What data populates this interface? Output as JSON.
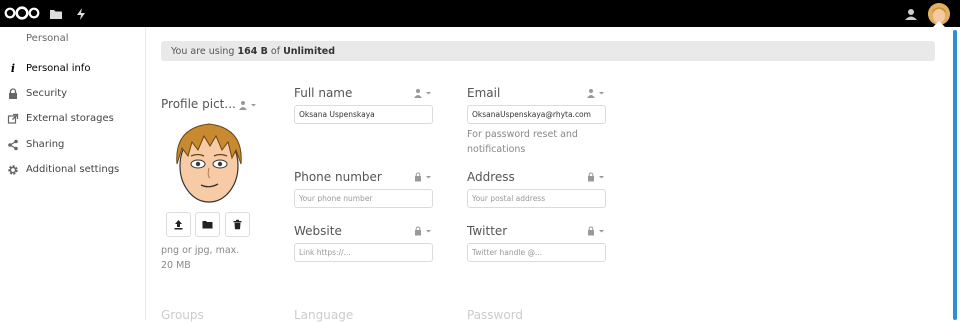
{
  "sidebar": {
    "section_title": "Personal",
    "items": [
      {
        "label": "Personal info",
        "icon": "info-icon"
      },
      {
        "label": "Security",
        "icon": "lock-icon"
      },
      {
        "label": "External storages",
        "icon": "external-link-icon"
      },
      {
        "label": "Sharing",
        "icon": "share-icon"
      },
      {
        "label": "Additional settings",
        "icon": "gear-icon"
      }
    ]
  },
  "quota": {
    "prefix": "You are using ",
    "used": "164 B",
    "middle": " of ",
    "total": "Unlimited"
  },
  "profile_picture": {
    "label": "Profile pict...",
    "hint": "png or jpg, max. 20 MB"
  },
  "fields": {
    "full_name": {
      "label": "Full name",
      "value": "Oksana Uspenskaya"
    },
    "email": {
      "label": "Email",
      "value": "OksanaUspenskaya@rhyta.com",
      "hint": "For password reset and notifications"
    },
    "phone": {
      "label": "Phone number",
      "placeholder": "Your phone number"
    },
    "address": {
      "label": "Address",
      "placeholder": "Your postal address"
    },
    "website": {
      "label": "Website",
      "placeholder": "Link https://..."
    },
    "twitter": {
      "label": "Twitter",
      "placeholder": "Twitter handle @..."
    }
  },
  "below_fold": {
    "groups": "Groups",
    "language": "Language",
    "password": "Password"
  },
  "colors": {
    "accent": "#2d8fdc",
    "topbar": "#000000"
  }
}
